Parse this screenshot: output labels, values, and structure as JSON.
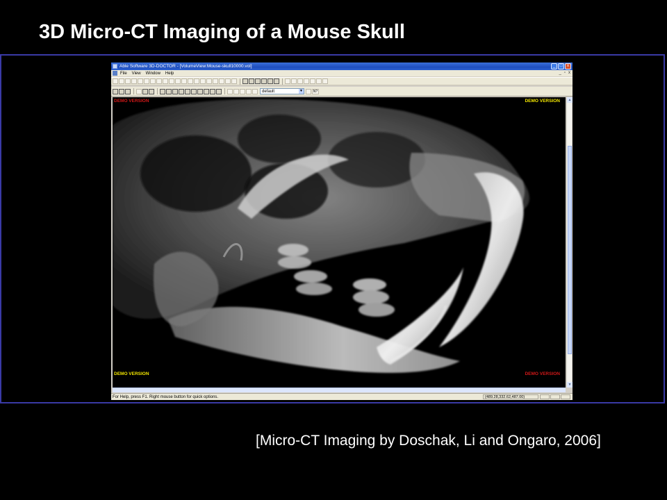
{
  "slide": {
    "title": "3D Micro-CT Imaging of a Mouse Skull",
    "caption": "[Micro-CT Imaging by Doschak, Li and Ongaro, 2006]"
  },
  "window": {
    "title": "Able Software 3D-DOCTOR - [VolumeView:Mouse-skull10000.vol]",
    "controls": {
      "minimize": "_",
      "maximize": "□",
      "close": "x"
    }
  },
  "menubar": {
    "items": [
      "File",
      "View",
      "Window",
      "Help"
    ],
    "child_controls": [
      "_",
      "▫",
      "x"
    ]
  },
  "toolbar": {
    "combo_value": "default",
    "help_label": "N?"
  },
  "viewport": {
    "watermarks": {
      "top_left": "DEMO VERSION",
      "top_right": "DEMO VERSION",
      "bottom_left": "DEMO VERSION",
      "bottom_right": "DEMO VERSION"
    },
    "colors": {
      "watermark_yellow": "#f2e600",
      "watermark_red": "#d01818",
      "background": "#000000"
    }
  },
  "statusbar": {
    "help_text": "For Help, press F1. Right mouse button for quick options.",
    "coordinates": "(489.28,332.62,487.00)"
  },
  "colors": {
    "frame_border": "#3a3aa6",
    "title_text": "#ffffff",
    "slide_background": "#000000"
  }
}
